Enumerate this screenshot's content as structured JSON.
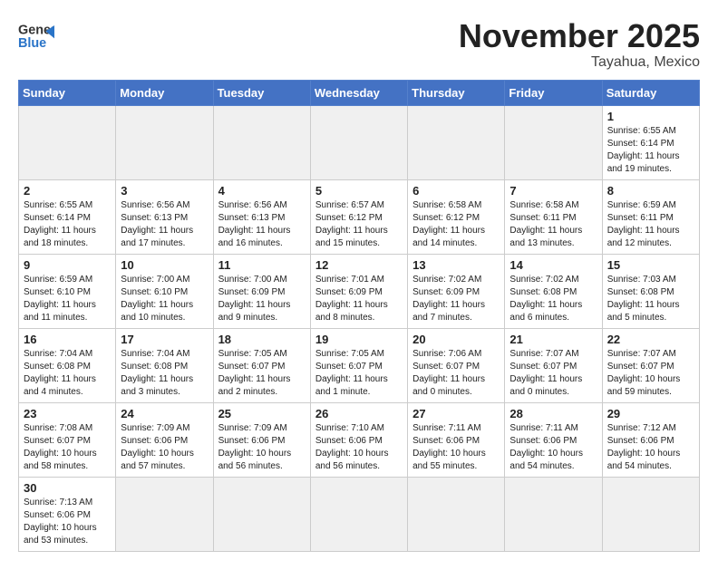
{
  "header": {
    "logo_general": "General",
    "logo_blue": "Blue",
    "month_year": "November 2025",
    "location": "Tayahua, Mexico"
  },
  "weekdays": [
    "Sunday",
    "Monday",
    "Tuesday",
    "Wednesday",
    "Thursday",
    "Friday",
    "Saturday"
  ],
  "weeks": [
    [
      {
        "day": "",
        "info": ""
      },
      {
        "day": "",
        "info": ""
      },
      {
        "day": "",
        "info": ""
      },
      {
        "day": "",
        "info": ""
      },
      {
        "day": "",
        "info": ""
      },
      {
        "day": "",
        "info": ""
      },
      {
        "day": "1",
        "info": "Sunrise: 6:55 AM\nSunset: 6:14 PM\nDaylight: 11 hours and 19 minutes."
      }
    ],
    [
      {
        "day": "2",
        "info": "Sunrise: 6:55 AM\nSunset: 6:14 PM\nDaylight: 11 hours and 18 minutes."
      },
      {
        "day": "3",
        "info": "Sunrise: 6:56 AM\nSunset: 6:13 PM\nDaylight: 11 hours and 17 minutes."
      },
      {
        "day": "4",
        "info": "Sunrise: 6:56 AM\nSunset: 6:13 PM\nDaylight: 11 hours and 16 minutes."
      },
      {
        "day": "5",
        "info": "Sunrise: 6:57 AM\nSunset: 6:12 PM\nDaylight: 11 hours and 15 minutes."
      },
      {
        "day": "6",
        "info": "Sunrise: 6:58 AM\nSunset: 6:12 PM\nDaylight: 11 hours and 14 minutes."
      },
      {
        "day": "7",
        "info": "Sunrise: 6:58 AM\nSunset: 6:11 PM\nDaylight: 11 hours and 13 minutes."
      },
      {
        "day": "8",
        "info": "Sunrise: 6:59 AM\nSunset: 6:11 PM\nDaylight: 11 hours and 12 minutes."
      }
    ],
    [
      {
        "day": "9",
        "info": "Sunrise: 6:59 AM\nSunset: 6:10 PM\nDaylight: 11 hours and 11 minutes."
      },
      {
        "day": "10",
        "info": "Sunrise: 7:00 AM\nSunset: 6:10 PM\nDaylight: 11 hours and 10 minutes."
      },
      {
        "day": "11",
        "info": "Sunrise: 7:00 AM\nSunset: 6:09 PM\nDaylight: 11 hours and 9 minutes."
      },
      {
        "day": "12",
        "info": "Sunrise: 7:01 AM\nSunset: 6:09 PM\nDaylight: 11 hours and 8 minutes."
      },
      {
        "day": "13",
        "info": "Sunrise: 7:02 AM\nSunset: 6:09 PM\nDaylight: 11 hours and 7 minutes."
      },
      {
        "day": "14",
        "info": "Sunrise: 7:02 AM\nSunset: 6:08 PM\nDaylight: 11 hours and 6 minutes."
      },
      {
        "day": "15",
        "info": "Sunrise: 7:03 AM\nSunset: 6:08 PM\nDaylight: 11 hours and 5 minutes."
      }
    ],
    [
      {
        "day": "16",
        "info": "Sunrise: 7:04 AM\nSunset: 6:08 PM\nDaylight: 11 hours and 4 minutes."
      },
      {
        "day": "17",
        "info": "Sunrise: 7:04 AM\nSunset: 6:08 PM\nDaylight: 11 hours and 3 minutes."
      },
      {
        "day": "18",
        "info": "Sunrise: 7:05 AM\nSunset: 6:07 PM\nDaylight: 11 hours and 2 minutes."
      },
      {
        "day": "19",
        "info": "Sunrise: 7:05 AM\nSunset: 6:07 PM\nDaylight: 11 hours and 1 minute."
      },
      {
        "day": "20",
        "info": "Sunrise: 7:06 AM\nSunset: 6:07 PM\nDaylight: 11 hours and 0 minutes."
      },
      {
        "day": "21",
        "info": "Sunrise: 7:07 AM\nSunset: 6:07 PM\nDaylight: 11 hours and 0 minutes."
      },
      {
        "day": "22",
        "info": "Sunrise: 7:07 AM\nSunset: 6:07 PM\nDaylight: 10 hours and 59 minutes."
      }
    ],
    [
      {
        "day": "23",
        "info": "Sunrise: 7:08 AM\nSunset: 6:07 PM\nDaylight: 10 hours and 58 minutes."
      },
      {
        "day": "24",
        "info": "Sunrise: 7:09 AM\nSunset: 6:06 PM\nDaylight: 10 hours and 57 minutes."
      },
      {
        "day": "25",
        "info": "Sunrise: 7:09 AM\nSunset: 6:06 PM\nDaylight: 10 hours and 56 minutes."
      },
      {
        "day": "26",
        "info": "Sunrise: 7:10 AM\nSunset: 6:06 PM\nDaylight: 10 hours and 56 minutes."
      },
      {
        "day": "27",
        "info": "Sunrise: 7:11 AM\nSunset: 6:06 PM\nDaylight: 10 hours and 55 minutes."
      },
      {
        "day": "28",
        "info": "Sunrise: 7:11 AM\nSunset: 6:06 PM\nDaylight: 10 hours and 54 minutes."
      },
      {
        "day": "29",
        "info": "Sunrise: 7:12 AM\nSunset: 6:06 PM\nDaylight: 10 hours and 54 minutes."
      }
    ],
    [
      {
        "day": "30",
        "info": "Sunrise: 7:13 AM\nSunset: 6:06 PM\nDaylight: 10 hours and 53 minutes."
      },
      {
        "day": "",
        "info": ""
      },
      {
        "day": "",
        "info": ""
      },
      {
        "day": "",
        "info": ""
      },
      {
        "day": "",
        "info": ""
      },
      {
        "day": "",
        "info": ""
      },
      {
        "day": "",
        "info": ""
      }
    ]
  ]
}
